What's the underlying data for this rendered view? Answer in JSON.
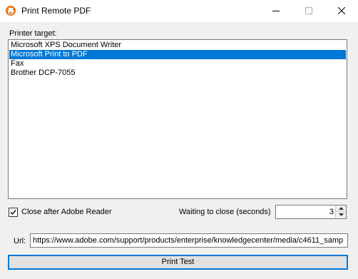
{
  "window": {
    "title": "Print Remote PDF",
    "icon": "printer-pdf-icon"
  },
  "printer": {
    "label": "Printer target:",
    "items": [
      {
        "label": "Microsoft XPS Document Writer",
        "selected": false
      },
      {
        "label": "Microsoft Print to PDF",
        "selected": true
      },
      {
        "label": "Fax",
        "selected": false
      },
      {
        "label": "Brother DCP-7055",
        "selected": false
      }
    ]
  },
  "options": {
    "close_after_label": "Close after Adobe Reader",
    "close_after_checked": true,
    "wait_label": "Waiting to close (seconds)",
    "wait_value": "3"
  },
  "url": {
    "label": "Url:",
    "value": "https://www.adobe.com/support/products/enterprise/knowledgecenter/media/c4611_samp"
  },
  "actions": {
    "print_test_label": "Print Test"
  },
  "colors": {
    "accent": "#0078d7",
    "background": "#f0f0f0"
  }
}
